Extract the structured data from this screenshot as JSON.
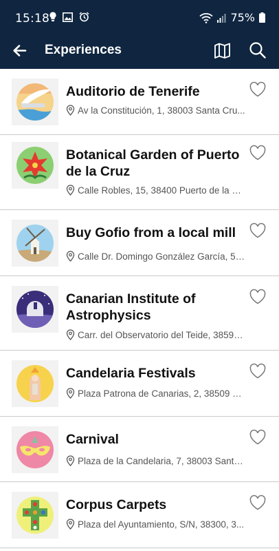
{
  "status_bar": {
    "time": "15:18",
    "battery": "75%",
    "icons": [
      "bulb-icon",
      "image-icon",
      "alarm-icon",
      "wifi-calling-icon",
      "signal-icon",
      "battery-icon"
    ]
  },
  "header": {
    "title": "Experiences",
    "back_icon": "arrow-left-icon",
    "map_icon": "map-icon",
    "search_icon": "search-icon",
    "background": "#0f2540"
  },
  "items": [
    {
      "title": "Auditorio de Tenerife",
      "address": "Av la Constitución, 1, 38003 Santa Cru...",
      "icon": "auditorium-icon"
    },
    {
      "title": "Botanical Garden of Puerto de la Cruz",
      "address": "Calle Robles, 15, 38400 Puerto de la Cr...",
      "icon": "flower-icon"
    },
    {
      "title": "Buy Gofio from a local mill",
      "address": "Calle Dr. Domingo González García, 5, ...",
      "icon": "windmill-icon"
    },
    {
      "title": "Canarian Institute of Astrophysics",
      "address": "Carr. del Observatorio del Teide, 38591...",
      "icon": "observatory-icon"
    },
    {
      "title": "Candelaria Festivals",
      "address": "Plaza Patrona de Canarias, 2, 38509 C...",
      "icon": "virgin-icon"
    },
    {
      "title": "Carnival",
      "address": "Plaza de la Candelaria, 7, 38003 Santa...",
      "icon": "carnival-mask-icon"
    },
    {
      "title": "Corpus Carpets",
      "address": "Plaza del Ayuntamiento, S/N, 38300, 3...",
      "icon": "flower-cross-icon"
    }
  ]
}
